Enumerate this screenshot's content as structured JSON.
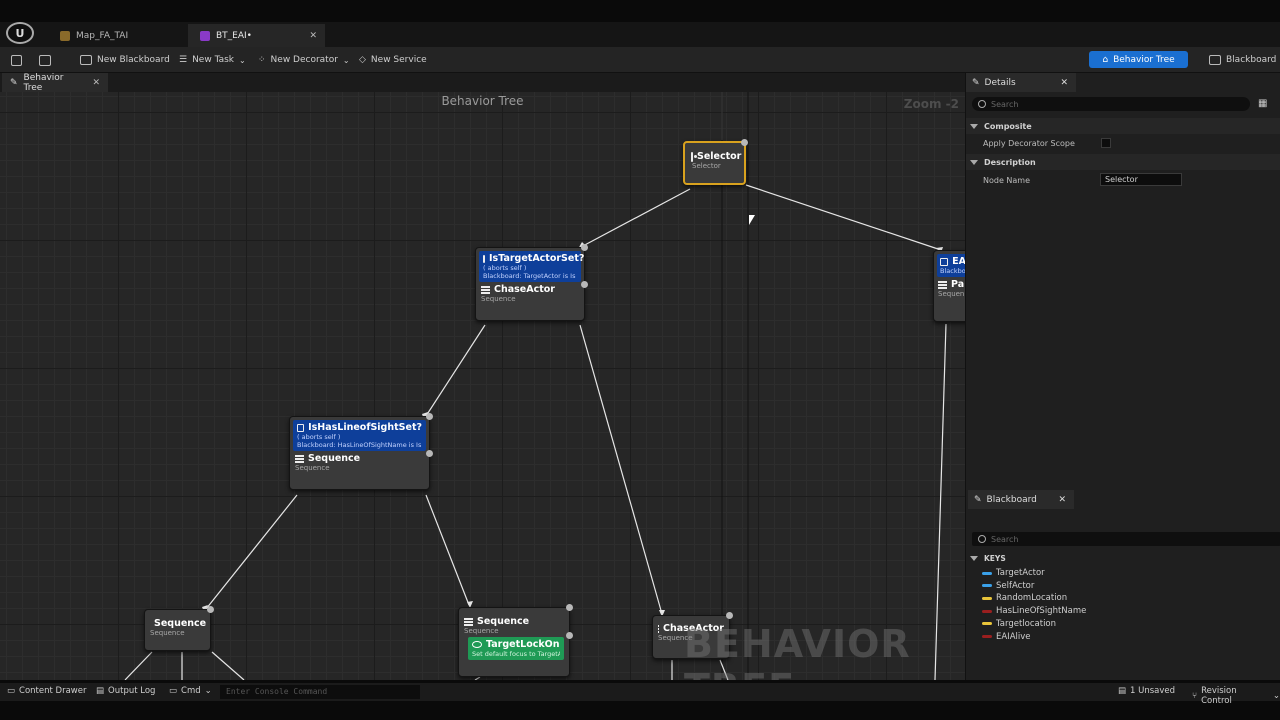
{
  "tabs": [
    {
      "label": "Map_FA_TAI"
    },
    {
      "label": "BT_EAI•"
    }
  ],
  "toolbar": {
    "new_blackboard": "New Blackboard",
    "new_task": "New Task",
    "new_decorator": "New Decorator",
    "new_service": "New Service",
    "mode_behavior_tree": "Behavior Tree",
    "mode_blackboard": "Blackboard"
  },
  "graph": {
    "tab_label": "Behavior Tree",
    "title": "Behavior Tree",
    "zoom": "Zoom -2",
    "watermark": "BEHAVIOR TREE"
  },
  "nodes": {
    "selector": {
      "title": "Selector",
      "sub": "Selector"
    },
    "chase1": {
      "decorator_title": "IsTargetActorSet?",
      "decorator_aborts": "( aborts self )",
      "decorator_desc": "Blackboard: TargetActor is Is Set",
      "title": "ChaseActor",
      "sub": "Sequence"
    },
    "right_partial": {
      "decorator_title": "EA",
      "decorator_desc": "Blackbo",
      "title": "Pa",
      "sub": "Sequen"
    },
    "seq_los": {
      "decorator_title": "IsHasLineofSightSet?",
      "decorator_aborts": "( aborts self )",
      "decorator_desc": "Blackboard: HasLineOfSightName is Is Set",
      "title": "Sequence",
      "sub": "Sequence"
    },
    "seq_left": {
      "title": "Sequence",
      "sub": "Sequence"
    },
    "seq_mid": {
      "title": "Sequence",
      "sub": "Sequence",
      "service_title": "TargetLockOn",
      "service_desc": "Set default focus to TargetActor"
    },
    "chase2": {
      "title": "ChaseActor",
      "sub": "Sequence"
    }
  },
  "details": {
    "tab_label": "Details",
    "search_placeholder": "Search",
    "category_composite": "Composite",
    "apply_decorator_scope": "Apply Decorator Scope",
    "category_description": "Description",
    "node_name_label": "Node Name",
    "node_name_value": "Selector"
  },
  "blackboard": {
    "tab_label": "Blackboard",
    "search_placeholder": "Search",
    "keys_header": "KEYS",
    "keys": [
      {
        "name": "TargetActor",
        "color": "#3aa0e8"
      },
      {
        "name": "SelfActor",
        "color": "#3aa0e8"
      },
      {
        "name": "RandomLocation",
        "color": "#e8c43a"
      },
      {
        "name": "HasLineOfSightName",
        "color": "#9a1f1f"
      },
      {
        "name": "Targetlocation",
        "color": "#e8c43a"
      },
      {
        "name": "EAIAlive",
        "color": "#9a1f1f"
      }
    ]
  },
  "statusbar": {
    "content_drawer": "Content Drawer",
    "output_log": "Output Log",
    "cmd": "Cmd",
    "console_placeholder": "Enter Console Command",
    "unsaved": "1 Unsaved",
    "revision_control": "Revision Control"
  }
}
